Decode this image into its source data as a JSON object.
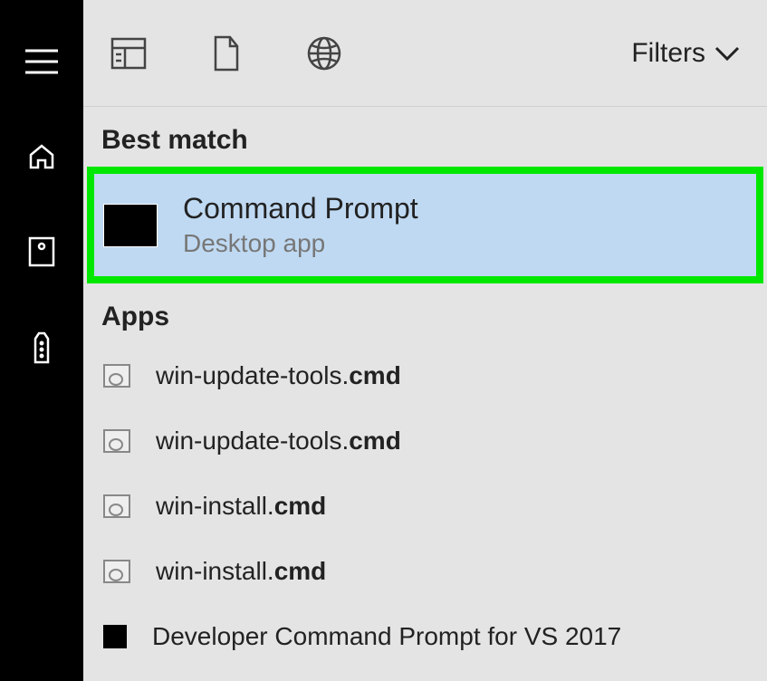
{
  "topbar": {
    "filters_label": "Filters"
  },
  "sections": {
    "best_match_label": "Best match",
    "apps_label": "Apps"
  },
  "best_match": {
    "title": "Command Prompt",
    "subtitle": "Desktop app"
  },
  "apps": [
    {
      "prefix": "win-update-tools.",
      "bold": "cmd",
      "icon": "script"
    },
    {
      "prefix": "win-update-tools.",
      "bold": "cmd",
      "icon": "script"
    },
    {
      "prefix": "win-install.",
      "bold": "cmd",
      "icon": "script"
    },
    {
      "prefix": "win-install.",
      "bold": "cmd",
      "icon": "script"
    },
    {
      "prefix": "Developer Command Prompt for VS 2017",
      "bold": "",
      "icon": "square"
    }
  ]
}
